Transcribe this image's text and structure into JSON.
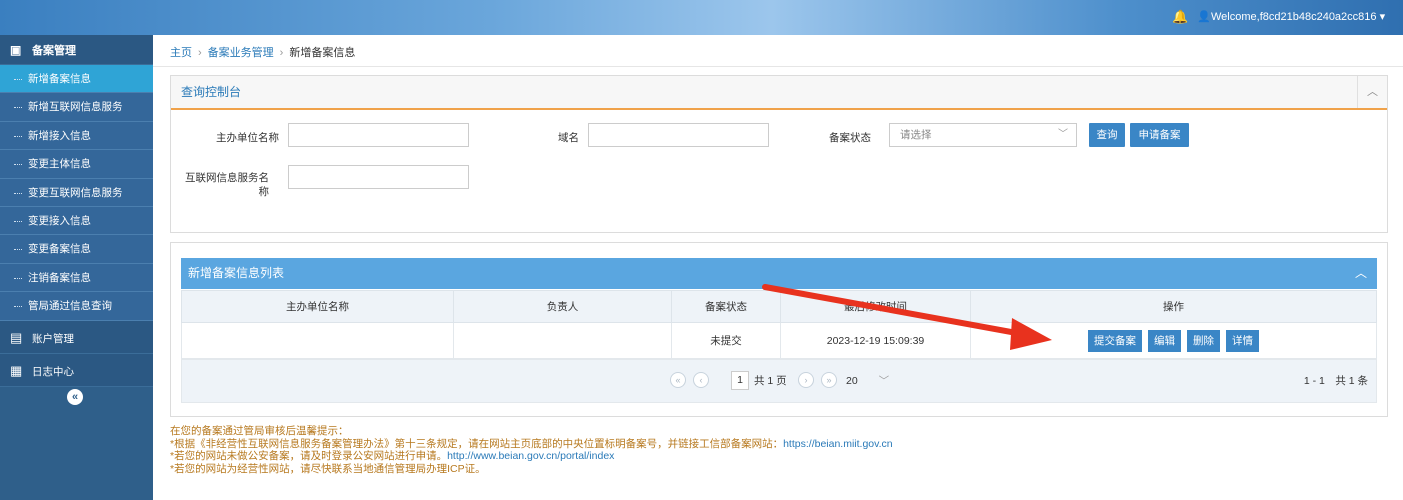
{
  "topbar": {
    "welcome": "Welcome,f8cd21b48c240a2cc816",
    "bell_icon": "bell-icon",
    "user_icon": "user-icon"
  },
  "sidebar": {
    "group1": {
      "label": "备案管理",
      "icon": "folder-icon"
    },
    "items": [
      {
        "label": "新增备案信息",
        "active": true
      },
      {
        "label": "新增互联网信息服务"
      },
      {
        "label": "新增接入信息"
      },
      {
        "label": "变更主体信息"
      },
      {
        "label": "变更互联网信息服务"
      },
      {
        "label": "变更接入信息"
      },
      {
        "label": "变更备案信息"
      },
      {
        "label": "注销备案信息"
      },
      {
        "label": "管局通过信息查询"
      }
    ],
    "group2": {
      "label": "账户管理",
      "icon": "account-icon"
    },
    "group3": {
      "label": "日志中心",
      "icon": "clipboard-icon"
    },
    "collapse": "«"
  },
  "breadcrumb": {
    "home": "主页",
    "section": "备案业务管理",
    "current": "新增备案信息",
    "sep": "›"
  },
  "query_panel": {
    "title": "查询控制台",
    "toggle": "︿",
    "fields": {
      "org_name_label": "主办单位名称",
      "domain_label": "域名",
      "status_label": "备案状态",
      "status_placeholder": "请选择",
      "service_name_label_line1": "互联网信息服务名",
      "service_name_label_line2": "称"
    },
    "buttons": {
      "query": "查询",
      "apply": "申请备案"
    }
  },
  "list_panel": {
    "title": "新增备案信息列表",
    "toggle": "︿",
    "columns": [
      "主办单位名称",
      "负责人",
      "备案状态",
      "最后修改时间",
      "操作"
    ],
    "rows": [
      {
        "org": "",
        "owner": "",
        "status": "未提交",
        "time": "2023-12-19 15:09:39",
        "ops": [
          "提交备案",
          "编辑",
          "删除",
          "详情"
        ]
      }
    ],
    "pager": {
      "first": "«",
      "prev": "‹",
      "page": "1",
      "total_pages": "共 1 页",
      "next": "›",
      "last": "»",
      "page_size": "20",
      "summary": "1 - 1　共 1 条"
    }
  },
  "tips": {
    "line1": "在您的备案通过管局审核后温馨提示：",
    "line2_text": "*根据《非经营性互联网信息服务备案管理办法》第十三条规定，请在网站主页底部的中央位置标明备案号，并链接工信部备案网站：",
    "line2_url": "https://beian.miit.gov.cn",
    "line3_text": "*若您的网站未做公安备案，请及时登录公安网站进行申请。",
    "line3_url": "http://www.beian.gov.cn/portal/index",
    "line4": "*若您的网站为经营性网站，请尽快联系当地通信管理局办理ICP证。"
  },
  "colors": {
    "sidebar": "#2f5f8a",
    "active_item": "#2fa4d6",
    "button": "#3a86c6",
    "header_bar": "#5aa6e0",
    "tip_text": "#b7791f",
    "arrow": "#e8321e"
  }
}
